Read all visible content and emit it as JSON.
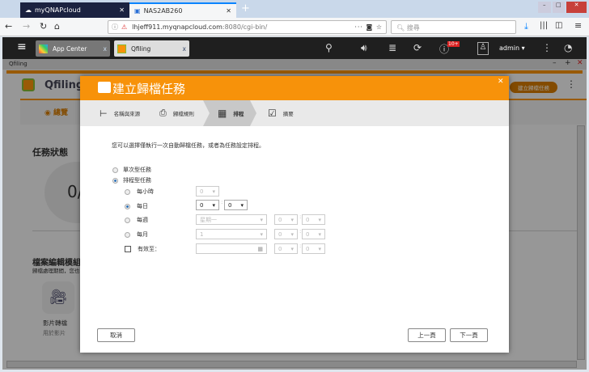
{
  "browser": {
    "tabs": [
      {
        "label": "myQNAPcloud"
      },
      {
        "label": "NAS2AB260"
      }
    ],
    "url_host": "lhjeff911.myqnapcloud.com",
    "url_rest": ":8080/cgi-bin/",
    "search_placeholder": "搜尋"
  },
  "qnap": {
    "apps": [
      {
        "label": "App Center"
      },
      {
        "label": "Qfiling"
      }
    ],
    "user": "admin ▾",
    "badge": "10+"
  },
  "window": {
    "title": "Qfiling"
  },
  "background": {
    "app_name": "Qfiling",
    "tab": "總覽",
    "create_button": "建立歸檔任務",
    "task_status": "任務狀態",
    "count": "0/",
    "module_title": "檔案編輯模組",
    "module_desc": "歸檔處理期間，您也",
    "video_title": "影片轉檔",
    "video_desc": "用於影片"
  },
  "modal": {
    "title": "建立歸檔任務",
    "steps": [
      {
        "label": "名稱與來源"
      },
      {
        "label": "歸檔規則"
      },
      {
        "label": "排程"
      },
      {
        "label": "摘要"
      }
    ],
    "intro": "您可以選擇僅執行一次自動歸檔任務，或者為任務設定排程。",
    "once": "單次型任務",
    "scheduled": "排程型任務",
    "hourly": {
      "label": "每小時",
      "value": "0"
    },
    "daily": {
      "label": "每日",
      "hour": "0",
      "minute": "0"
    },
    "weekly": {
      "label": "每週",
      "day": "星期一",
      "hour": "0",
      "minute": "0"
    },
    "monthly": {
      "label": "每月",
      "day": "1",
      "hour": "0",
      "minute": "0"
    },
    "valid_until": {
      "label": "有效至：",
      "date": "",
      "hour": "0",
      "minute": "0"
    },
    "cancel": "取消",
    "prev": "上一頁",
    "next": "下一頁"
  }
}
